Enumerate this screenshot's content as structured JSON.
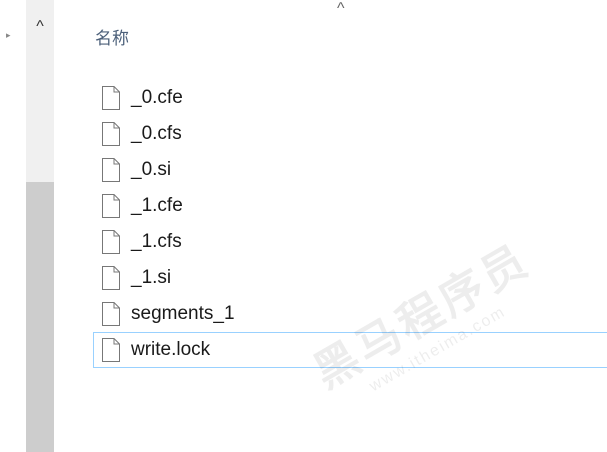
{
  "nav": {
    "expander_glyph": "▸",
    "scroll_up_glyph": "^"
  },
  "header": {
    "sort_glyph": "^",
    "column_name": "名称"
  },
  "files": [
    {
      "name": "_0.cfe",
      "selected": false
    },
    {
      "name": "_0.cfs",
      "selected": false
    },
    {
      "name": "_0.si",
      "selected": false
    },
    {
      "name": "_1.cfe",
      "selected": false
    },
    {
      "name": "_1.cfs",
      "selected": false
    },
    {
      "name": "_1.si",
      "selected": false
    },
    {
      "name": "segments_1",
      "selected": false
    },
    {
      "name": "write.lock",
      "selected": true
    }
  ],
  "watermark": {
    "main": "黑马程序员",
    "sub": "www.itheima.com"
  },
  "colors": {
    "header_text": "#4c607a",
    "selection_border": "#99d1ff",
    "scroll_thumb": "#cdcdcd"
  }
}
